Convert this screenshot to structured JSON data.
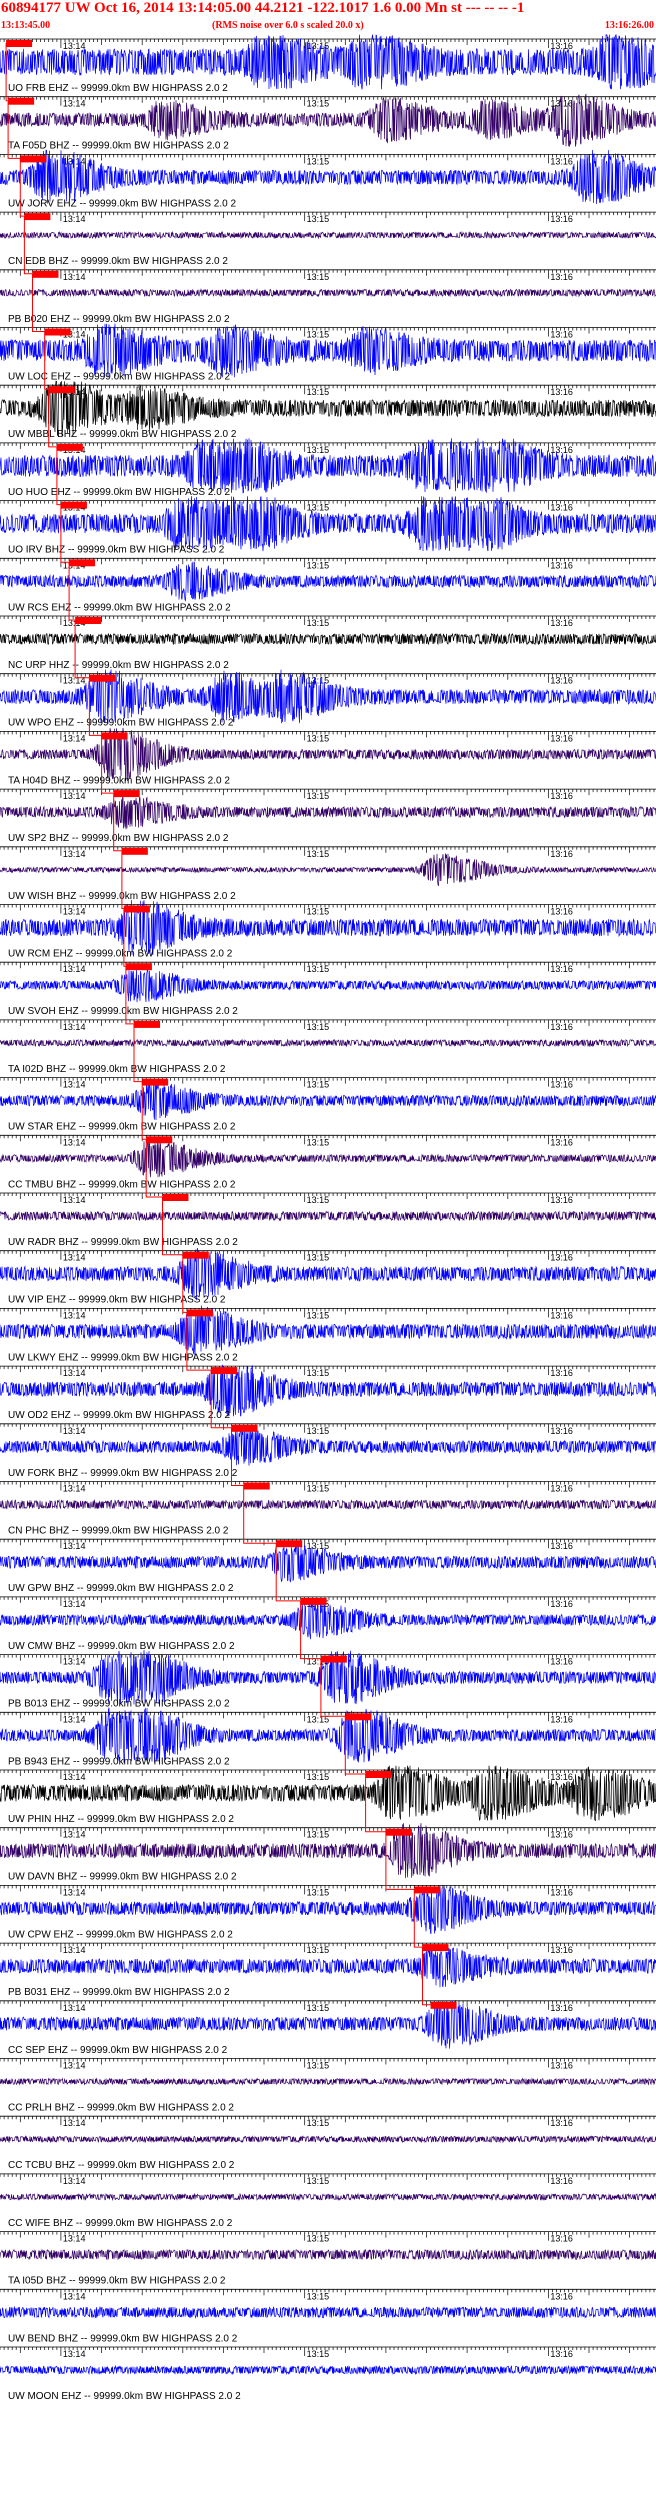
{
  "header": {
    "title": "60894177 UW Oct 16, 2014 13:14:05.00   44.2121 -122.1017  1.6 0.00 Mn st --- -- --  -1",
    "start_time": "13:13:45.00",
    "note": "(RMS noise over 6.0 s scaled 20.0 x)",
    "end_time": "13:16:26.00"
  },
  "colors": {
    "header_text": "#ff0000",
    "pick_marker": "#ff0000",
    "grid": "#000000",
    "blue_trace": "#0000ff",
    "purple_trace": "#330066",
    "black_trace": "#000000"
  },
  "chart_data": {
    "type": "line",
    "title": "60894177 UW Oct 16, 2014 13:14:05.00   44.2121 -122.1017  1.6 0.00 Mn st --- -- --  -1",
    "x_unit": "time",
    "xlim": [
      "13:13:45.00",
      "13:16:26.00"
    ],
    "tick_labels": [
      "13:14",
      "13:15",
      "13:16"
    ],
    "series": [
      {
        "name": "UO FRB EHZ -- 99999.0km BW  HIGHPASS  2.0  2",
        "color": "blue",
        "pick": "13:13:46.5",
        "amplitude": 0.55,
        "bursts": [
          [
            "13:14:50",
            0.8
          ],
          [
            "13:15:15",
            0.9
          ],
          [
            "13:16:15",
            0.8
          ]
        ]
      },
      {
        "name": "TA F05D BHZ -- 99999.0km BW  HIGHPASS  2.0  2",
        "color": "purple",
        "pick": "13:13:47.0",
        "amplitude": 0.28,
        "bursts": [
          [
            "13:14:25",
            0.6
          ],
          [
            "13:15:20",
            0.7
          ],
          [
            "13:15:45",
            0.6
          ],
          [
            "13:16:05",
            0.9
          ]
        ]
      },
      {
        "name": "UW JORV EHZ -- 99999.0km BW  HIGHPASS  2.0  2",
        "color": "blue",
        "pick": "13:13:50.0",
        "amplitude": 0.3,
        "bursts": [
          [
            "13:13:57",
            1.0
          ],
          [
            "13:16:10",
            1.0
          ]
        ]
      },
      {
        "name": "CN EDB BHZ -- 99999.0km BW  HIGHPASS  2.0  2",
        "color": "purple",
        "pick": "13:13:51.0",
        "amplitude": 0.12,
        "bursts": []
      },
      {
        "name": "PB B020 EHZ -- 99999.0km BW  HIGHPASS  2.0  2",
        "color": "purple",
        "pick": "13:13:53.0",
        "amplitude": 0.14,
        "bursts": []
      },
      {
        "name": "UW LOC EHZ -- 99999.0km BW  HIGHPASS  2.0  2",
        "color": "blue",
        "pick": "13:13:56.0",
        "amplitude": 0.45,
        "bursts": [
          [
            "13:14:10",
            0.8
          ],
          [
            "13:14:40",
            0.7
          ],
          [
            "13:15:15",
            0.6
          ]
        ]
      },
      {
        "name": "UW MBBL BHZ -- 99999.0km BW  HIGHPASS  2.0  2",
        "color": "black",
        "pick": "13:13:57.0",
        "amplitude": 0.35,
        "bursts": [
          [
            "13:13:59",
            1.0
          ],
          [
            "13:14:20",
            0.6
          ]
        ]
      },
      {
        "name": "UO HUO EHZ -- 99999.0km BW  HIGHPASS  2.0  2",
        "color": "blue",
        "pick": "13:13:59.0",
        "amplitude": 0.45,
        "bursts": [
          [
            "13:14:35",
            1.0
          ],
          [
            "13:14:40",
            1.0
          ],
          [
            "13:15:30",
            0.9
          ],
          [
            "13:15:45",
            0.9
          ]
        ]
      },
      {
        "name": "UO IRV BHZ -- 99999.0km BW  HIGHPASS  2.0  2",
        "color": "blue",
        "pick": "13:14:00.0",
        "amplitude": 0.4,
        "bursts": [
          [
            "13:14:30",
            1.0
          ],
          [
            "13:14:45",
            1.0
          ],
          [
            "13:15:30",
            1.0
          ],
          [
            "13:15:40",
            1.0
          ]
        ]
      },
      {
        "name": "UW RCS EHZ -- 99999.0km BW  HIGHPASS  2.0  2",
        "color": "blue",
        "pick": "13:14:02.0",
        "amplitude": 0.25,
        "bursts": [
          [
            "13:14:30",
            0.6
          ]
        ]
      },
      {
        "name": "NC URP HHZ -- 99999.0km BW  HIGHPASS  2.0  2",
        "color": "black",
        "pick": "13:14:03.5",
        "amplitude": 0.22,
        "bursts": []
      },
      {
        "name": "UW WPO EHZ -- 99999.0km BW  HIGHPASS  2.0  2",
        "color": "blue",
        "pick": "13:14:07.0",
        "amplitude": 0.3,
        "bursts": [
          [
            "13:14:10",
            0.9
          ],
          [
            "13:14:40",
            0.8
          ],
          [
            "13:14:55",
            0.8
          ]
        ]
      },
      {
        "name": "TA H04D BHZ -- 99999.0km BW  HIGHPASS  2.0  2",
        "color": "purple",
        "pick": "13:14:10.0",
        "amplitude": 0.2,
        "bursts": [
          [
            "13:14:13",
            1.0
          ]
        ]
      },
      {
        "name": "UW SP2 BHZ -- 99999.0km BW  HIGHPASS  2.0  2",
        "color": "purple",
        "pick": "13:14:13.0",
        "amplitude": 0.22,
        "bursts": [
          [
            "13:14:15",
            0.5
          ]
        ]
      },
      {
        "name": "UW WISH BHZ -- 99999.0km BW  HIGHPASS  2.0  2",
        "color": "purple",
        "pick": "13:14:15.0",
        "amplitude": 0.1,
        "bursts": [
          [
            "13:15:33",
            0.6
          ]
        ]
      },
      {
        "name": "UW RCM EHZ -- 99999.0km BW  HIGHPASS  2.0  2",
        "color": "blue",
        "pick": "13:14:15.5",
        "amplitude": 0.35,
        "bursts": [
          [
            "13:14:18",
            0.9
          ]
        ]
      },
      {
        "name": "UW SVOH EHZ -- 99999.0km BW  HIGHPASS  2.0  2",
        "color": "blue",
        "pick": "13:14:16.0",
        "amplitude": 0.18,
        "bursts": [
          [
            "13:14:18",
            0.6
          ]
        ]
      },
      {
        "name": "TA I02D BHZ -- 99999.0km BW  HIGHPASS  2.0  2",
        "color": "purple",
        "pick": "13:14:18.0",
        "amplitude": 0.13,
        "bursts": []
      },
      {
        "name": "UW STAR EHZ -- 99999.0km BW  HIGHPASS  2.0  2",
        "color": "blue",
        "pick": "13:14:20.0",
        "amplitude": 0.22,
        "bursts": [
          [
            "13:14:22",
            0.6
          ]
        ]
      },
      {
        "name": "CC TMBU BHZ -- 99999.0km BW  HIGHPASS  2.0  2",
        "color": "purple",
        "pick": "13:14:21.0",
        "amplitude": 0.15,
        "bursts": [
          [
            "13:14:22",
            0.7
          ]
        ]
      },
      {
        "name": "UW RADR BHZ -- 99999.0km BW  HIGHPASS  2.0  2",
        "color": "purple",
        "pick": "13:14:25.0",
        "amplitude": 0.18,
        "bursts": []
      },
      {
        "name": "UW VIP EHZ -- 99999.0km BW  HIGHPASS  2.0  2",
        "color": "blue",
        "pick": "13:14:30.0",
        "amplitude": 0.3,
        "bursts": [
          [
            "13:14:33",
            0.8
          ]
        ]
      },
      {
        "name": "UW LKWY EHZ -- 99999.0km BW  HIGHPASS  2.0  2",
        "color": "blue",
        "pick": "13:14:31.0",
        "amplitude": 0.3,
        "bursts": [
          [
            "13:14:33",
            0.8
          ]
        ]
      },
      {
        "name": "UW OD2 EHZ -- 99999.0km BW  HIGHPASS  2.0  2",
        "color": "blue",
        "pick": "13:14:37.0",
        "amplitude": 0.3,
        "bursts": [
          [
            "13:14:40",
            1.0
          ]
        ]
      },
      {
        "name": "UW FORK BHZ -- 99999.0km BW  HIGHPASS  2.0  2",
        "color": "blue",
        "pick": "13:14:42.0",
        "amplitude": 0.25,
        "bursts": [
          [
            "13:14:44",
            0.6
          ]
        ]
      },
      {
        "name": "CN PHC BHZ -- 99999.0km BW  HIGHPASS  2.0  2",
        "color": "purple",
        "pick": "13:14:45.0",
        "amplitude": 0.18,
        "bursts": []
      },
      {
        "name": "UW GPW BHZ -- 99999.0km BW  HIGHPASS  2.0  2",
        "color": "blue",
        "pick": "13:14:53.0",
        "amplitude": 0.25,
        "bursts": [
          [
            "13:14:55",
            0.6
          ]
        ]
      },
      {
        "name": "UW CMW BHZ -- 99999.0km BW  HIGHPASS  2.0  2",
        "color": "blue",
        "pick": "13:14:59.0",
        "amplitude": 0.22,
        "bursts": [
          [
            "13:15:01",
            0.6
          ]
        ]
      },
      {
        "name": "PB B013 EHZ -- 99999.0km BW  HIGHPASS  2.0  2",
        "color": "blue",
        "pick": "13:15:04.0",
        "amplitude": 0.25,
        "bursts": [
          [
            "13:14:12",
            0.9
          ],
          [
            "13:14:20",
            0.7
          ],
          [
            "13:15:08",
            1.0
          ]
        ]
      },
      {
        "name": "PB B943 EHZ -- 99999.0km BW  HIGHPASS  2.0  2",
        "color": "blue",
        "pick": "13:15:10.0",
        "amplitude": 0.25,
        "bursts": [
          [
            "13:14:12",
            0.9
          ],
          [
            "13:14:20",
            0.7
          ],
          [
            "13:15:12",
            1.0
          ]
        ]
      },
      {
        "name": "UW PHIN HHZ -- 99999.0km BW  HIGHPASS  2.0  2",
        "color": "black",
        "pick": "13:15:15.0",
        "amplitude": 0.35,
        "bursts": [
          [
            "13:15:22",
            1.0
          ],
          [
            "13:15:45",
            1.0
          ],
          [
            "13:16:10",
            1.0
          ]
        ]
      },
      {
        "name": "UW DAVN BHZ -- 99999.0km BW  HIGHPASS  2.0  2",
        "color": "purple",
        "pick": "13:15:20.0",
        "amplitude": 0.3,
        "bursts": [
          [
            "13:15:25",
            1.0
          ]
        ]
      },
      {
        "name": "UW CPW EHZ -- 99999.0km BW  HIGHPASS  2.0  2",
        "color": "blue",
        "pick": "13:15:27.0",
        "amplitude": 0.28,
        "bursts": [
          [
            "13:15:30",
            0.8
          ]
        ]
      },
      {
        "name": "PB B031 EHZ -- 99999.0km BW  HIGHPASS  2.0  2",
        "color": "blue",
        "pick": "13:15:29.0",
        "amplitude": 0.3,
        "bursts": [
          [
            "13:15:32",
            0.6
          ]
        ]
      },
      {
        "name": "CC SEP EHZ -- 99999.0km BW  HIGHPASS  2.0  2",
        "color": "blue",
        "pick": "13:15:31.0",
        "amplitude": 0.28,
        "bursts": [
          [
            "13:15:34",
            0.8
          ]
        ]
      },
      {
        "name": "CC PRLH BHZ -- 99999.0km BW  HIGHPASS  2.0  2",
        "color": "purple",
        "pick": "",
        "amplitude": 0.12,
        "bursts": []
      },
      {
        "name": "CC TCBU BHZ -- 99999.0km BW  HIGHPASS  2.0  2",
        "color": "purple",
        "pick": "",
        "amplitude": 0.12,
        "bursts": []
      },
      {
        "name": "CC WIFE BHZ -- 99999.0km BW  HIGHPASS  2.0  2",
        "color": "purple",
        "pick": "",
        "amplitude": 0.12,
        "bursts": []
      },
      {
        "name": "TA I05D BHZ -- 99999.0km BW  HIGHPASS  2.0  2",
        "color": "purple",
        "pick": "",
        "amplitude": 0.2,
        "bursts": []
      },
      {
        "name": "UW BEND BHZ -- 99999.0km BW  HIGHPASS  2.0  2",
        "color": "blue",
        "pick": "",
        "amplitude": 0.22,
        "bursts": []
      },
      {
        "name": "UW MOON EHZ -- 99999.0km BW  HIGHPASS  2.0  2",
        "color": "blue",
        "pick": "",
        "amplitude": 0.16,
        "bursts": []
      }
    ]
  }
}
